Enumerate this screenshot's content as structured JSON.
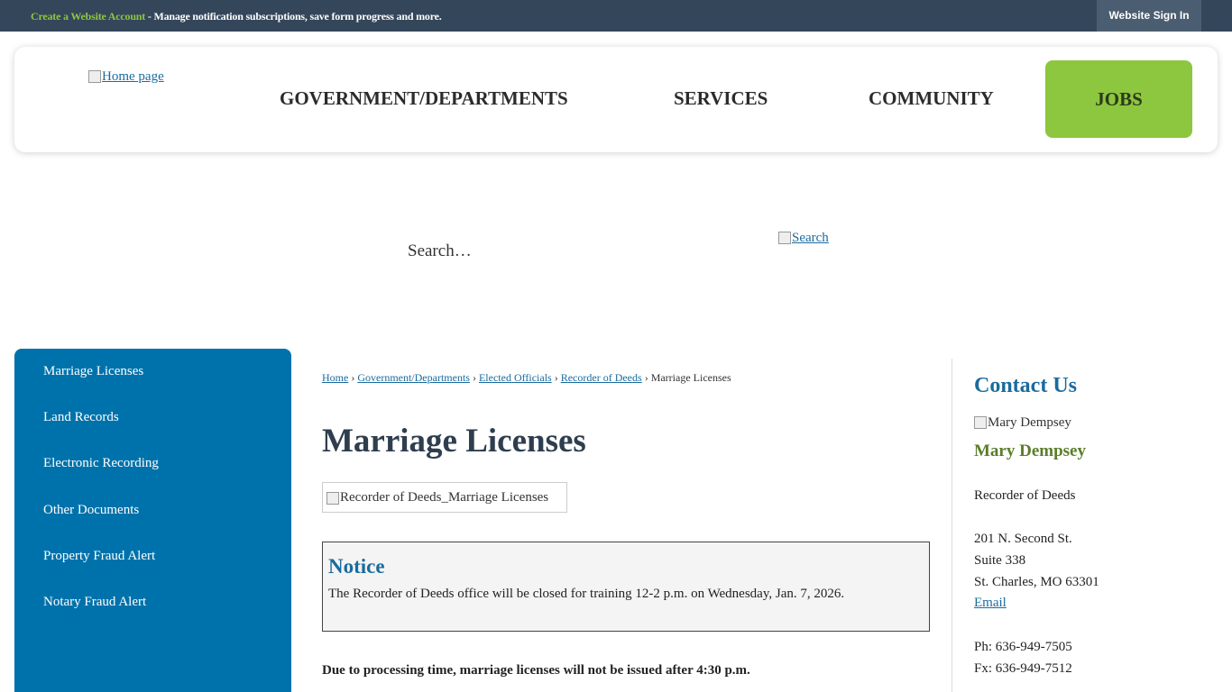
{
  "topbar": {
    "create_account": "Create a Website Account",
    "message": " - Manage notification subscriptions, save form progress and more.",
    "sign_in": "Website Sign In"
  },
  "header": {
    "logo_alt": "Home page",
    "nav": [
      "GOVERNMENT/DEPARTMENTS",
      "SERVICES",
      "COMMUNITY",
      "JOBS"
    ]
  },
  "search": {
    "placeholder": "Search…",
    "button_alt": "Search"
  },
  "sidebar": {
    "items": [
      "Marriage Licenses",
      "Land Records",
      "Electronic Recording",
      "Other Documents",
      "Property Fraud Alert",
      "Notary Fraud Alert"
    ]
  },
  "breadcrumb": {
    "links": [
      "Home",
      "Government/Departments",
      "Elected Officials",
      "Recorder of Deeds"
    ],
    "current": "Marriage Licenses",
    "separator": " › "
  },
  "main": {
    "title": "Marriage Licenses",
    "banner_alt": "Recorder of Deeds_Marriage Licenses",
    "notice_title": "Notice",
    "notice_text": "The Recorder of Deeds office will be closed for training 12-2 p.m. on Wednesday, Jan. 7, 2026.",
    "processing": "Due to processing time, marriage licenses will not be issued after 4:30 p.m."
  },
  "contact": {
    "title": "Contact Us",
    "photo_alt": "Mary Dempsey",
    "name": "Mary Dempsey",
    "role": "Recorder of Deeds",
    "address1": "201 N. Second St.",
    "address2": "Suite 338",
    "address3": "St. Charles, MO 63301",
    "email": "Email",
    "phone": "Ph: 636-949-7505",
    "fax": "Fx: 636-949-7512"
  },
  "colors": {
    "topbar": "#34465a",
    "accent_green": "#8dc63f",
    "sidebar_blue": "#0072ab",
    "link_blue": "#1a6b9e"
  }
}
